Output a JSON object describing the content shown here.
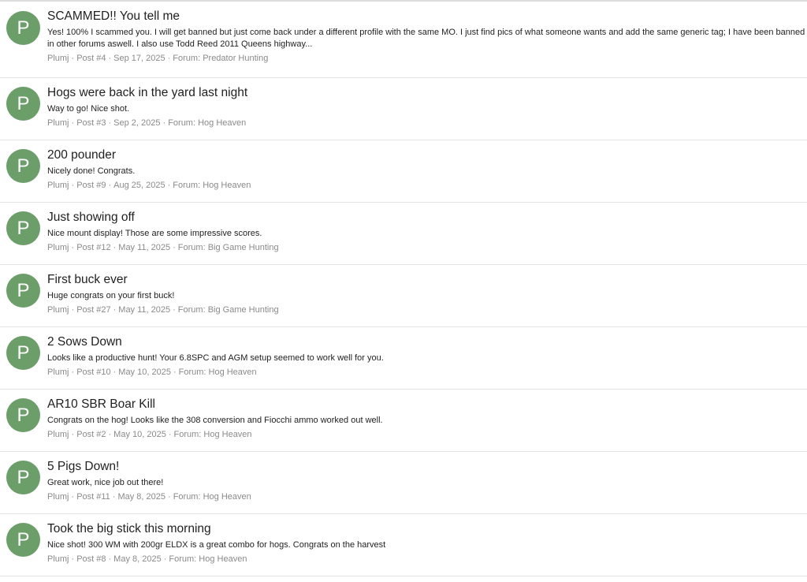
{
  "results": [
    {
      "avatar_letter": "P",
      "title": "SCAMMED!! You tell me",
      "snippet": "Yes! 100% I scammed you. I will get banned but just come back under a different profile with the same MO. I just find pics of what someone wants and add the same generic tag; I have been banned in other forums aswell. I also use Todd Reed 2011 Queens highway...",
      "author": "Plumj",
      "post": "Post #4",
      "date": "Sep 17, 2025",
      "forum": "Forum: Predator Hunting"
    },
    {
      "avatar_letter": "P",
      "title": "Hogs were back in the yard last night",
      "snippet": "Way to go! Nice shot.",
      "author": "Plumj",
      "post": "Post #3",
      "date": "Sep 2, 2025",
      "forum": "Forum: Hog Heaven"
    },
    {
      "avatar_letter": "P",
      "title": "200 pounder",
      "snippet": "Nicely done! Congrats.",
      "author": "Plumj",
      "post": "Post #9",
      "date": "Aug 25, 2025",
      "forum": "Forum: Hog Heaven"
    },
    {
      "avatar_letter": "P",
      "title": "Just showing off",
      "snippet": "Nice mount display! Those are some impressive scores.",
      "author": "Plumj",
      "post": "Post #12",
      "date": "May 11, 2025",
      "forum": "Forum: Big Game Hunting"
    },
    {
      "avatar_letter": "P",
      "title": "First buck ever",
      "snippet": "Huge congrats on your first buck!",
      "author": "Plumj",
      "post": "Post #27",
      "date": "May 11, 2025",
      "forum": "Forum: Big Game Hunting"
    },
    {
      "avatar_letter": "P",
      "title": "2 Sows Down",
      "snippet": "Looks like a productive hunt! Your 6.8SPC and AGM setup seemed to work well for you.",
      "author": "Plumj",
      "post": "Post #10",
      "date": "May 10, 2025",
      "forum": "Forum: Hog Heaven"
    },
    {
      "avatar_letter": "P",
      "title": "AR10 SBR Boar Kill",
      "snippet": "Congrats on the hog! Looks like the 308 conversion and Fiocchi ammo worked out well.",
      "author": "Plumj",
      "post": "Post #2",
      "date": "May 10, 2025",
      "forum": "Forum: Hog Heaven"
    },
    {
      "avatar_letter": "P",
      "title": "5 Pigs Down!",
      "snippet": "Great work, nice job out there!",
      "author": "Plumj",
      "post": "Post #11",
      "date": "May 8, 2025",
      "forum": "Forum: Hog Heaven"
    },
    {
      "avatar_letter": "P",
      "title": "Took the big stick this morning",
      "snippet": "Nice shot! 300 WM with 200gr ELDX is a great combo for hogs. Congrats on the harvest",
      "author": "Plumj",
      "post": "Post #8",
      "date": "May 8, 2025",
      "forum": "Forum: Hog Heaven"
    }
  ],
  "meta_separator": "·",
  "colors": {
    "avatar_bg": "#6c9e6a",
    "meta_text": "#8a8a8a",
    "divider": "#e3e3e3"
  }
}
